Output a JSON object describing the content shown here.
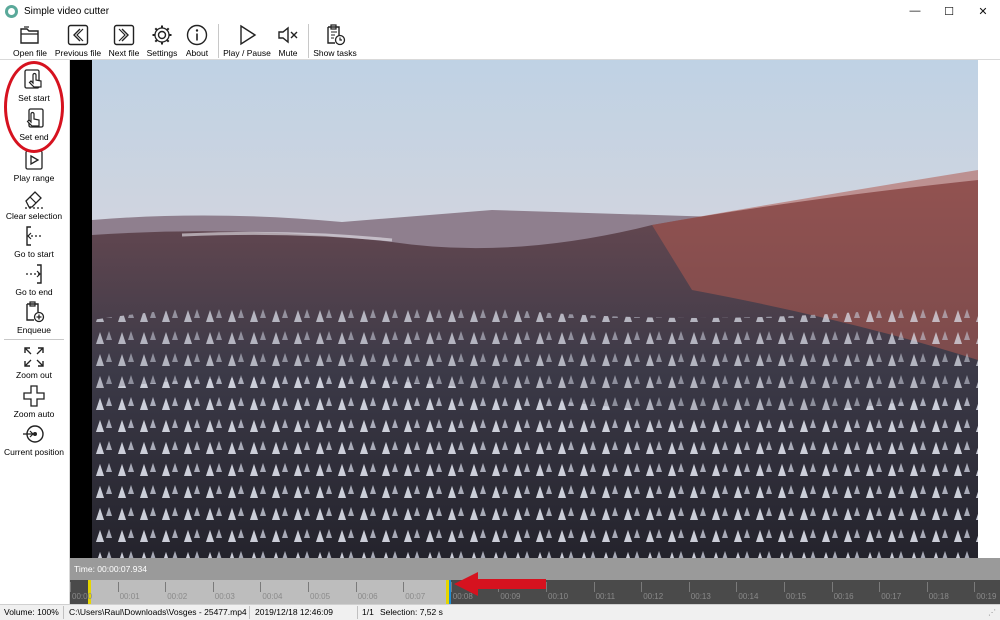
{
  "window": {
    "title": "Simple video cutter",
    "controls": {
      "minimize": "—",
      "maximize": "☐",
      "close": "✕"
    }
  },
  "toolbar": {
    "open_file": "Open file",
    "previous_file": "Previous file",
    "next_file": "Next file",
    "settings": "Settings",
    "about": "About",
    "play_pause": "Play / Pause",
    "mute": "Mute",
    "show_tasks": "Show tasks"
  },
  "sidebar": {
    "set_start": "Set start",
    "set_end": "Set end",
    "play_range": "Play range",
    "clear_selection": "Clear selection",
    "go_to_start": "Go to start",
    "go_to_end": "Go to end",
    "enqueue": "Enqueue",
    "zoom_out": "Zoom out",
    "zoom_auto": "Zoom auto",
    "current_position": "Current position"
  },
  "timeline": {
    "time_label": "Time: 00:00:07.934",
    "ticks": [
      "00:00",
      "00:01",
      "00:02",
      "00:03",
      "00:04",
      "00:05",
      "00:06",
      "00:07",
      "00:08",
      "00:09",
      "00:10",
      "00:11",
      "00:12",
      "00:13",
      "00:14",
      "00:15",
      "00:16",
      "00:17",
      "00:18",
      "00:19"
    ]
  },
  "status": {
    "volume": "Volume: 100%",
    "file_path": "C:\\Users\\Raul\\Downloads\\Vosges - 25477.mp4",
    "datetime": "2019/12/18 12:46:09",
    "file_index": "1/1",
    "selection": "Selection: 7,52 s"
  },
  "colors": {
    "annotation_red": "#d6121f",
    "selection_handle": "#e6d600",
    "position_marker": "#1e8fd6"
  }
}
